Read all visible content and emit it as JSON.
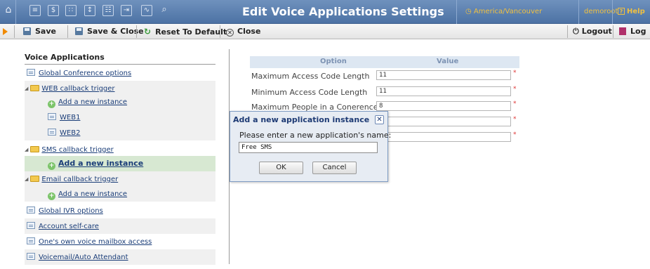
{
  "window": {
    "title": "Edit Voice Applications Settings",
    "timezone": "America/Vancouver",
    "user": "demoroot",
    "help_label": "Help",
    "nav_icons": [
      "home-icon",
      "list-icon",
      "dollar-icon",
      "grid-icon",
      "pin-icon",
      "table-icon",
      "arrow-in-icon",
      "chart-icon",
      "search-icon"
    ]
  },
  "toolbar": {
    "save": "Save",
    "save_close": "Save & Close",
    "reset": "Reset To Default",
    "close": "Close",
    "logout": "Logout",
    "log": "Log"
  },
  "sidebar": {
    "title": "Voice Applications",
    "items": [
      {
        "label": "Global Conference options",
        "kind": "doc",
        "level": 0
      },
      {
        "label": "WEB callback trigger",
        "kind": "folder",
        "level": 0
      },
      {
        "label": "Add a new instance",
        "kind": "add",
        "level": 1
      },
      {
        "label": "WEB1",
        "kind": "doc",
        "level": 1
      },
      {
        "label": "WEB2",
        "kind": "doc",
        "level": 1
      },
      {
        "label": "SMS callback trigger",
        "kind": "folder",
        "level": 0
      },
      {
        "label": "Add a new instance",
        "kind": "add",
        "level": 1,
        "selected": true
      },
      {
        "label": "Email callback trigger",
        "kind": "folder",
        "level": 0
      },
      {
        "label": "Add a new instance",
        "kind": "add",
        "level": 1
      },
      {
        "label": "Global IVR options",
        "kind": "doc",
        "level": 0
      },
      {
        "label": "Account self-care",
        "kind": "doc",
        "level": 0
      },
      {
        "label": "One's own voice mailbox access",
        "kind": "doc",
        "level": 0
      },
      {
        "label": "Voicemail/Auto Attendant",
        "kind": "doc",
        "level": 0
      }
    ]
  },
  "options": {
    "header_option": "Option",
    "header_value": "Value",
    "rows": [
      {
        "label": "Maximum Access Code Length",
        "value": "11"
      },
      {
        "label": "Minimum Access Code Length",
        "value": "11"
      },
      {
        "label": "Maximum People in a Conerence",
        "value": "8"
      },
      {
        "label": "",
        "value": ""
      },
      {
        "label": "",
        "value": ""
      }
    ],
    "required_mark": "*"
  },
  "dialog": {
    "title": "Add a new application instance",
    "prompt": "Please enter a new application's name:",
    "input_value": "Free SMS",
    "ok": "OK",
    "cancel": "Cancel",
    "close_symbol": "✕"
  },
  "colors": {
    "topbar": "#5a7fb0",
    "title_text": "#ffffff",
    "accent_orange": "#f0c040",
    "link": "#1a3d78",
    "selected_row": "#d7e8d2",
    "dialog_title": "#1d3a74"
  }
}
